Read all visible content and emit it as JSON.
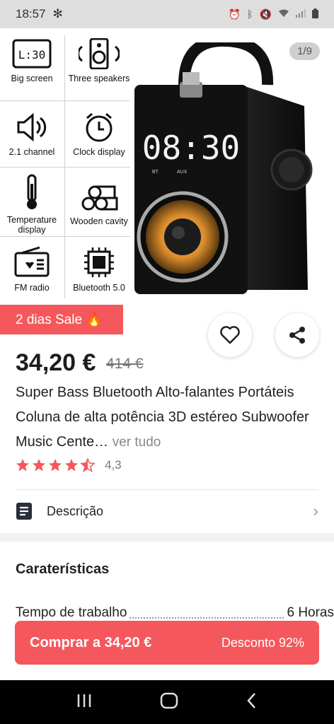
{
  "status": {
    "time": "18:57"
  },
  "hero": {
    "page_indicator": "1/9",
    "features": [
      {
        "label": "Big screen",
        "icon": "clock-display-icon"
      },
      {
        "label": "Three speakers",
        "icon": "speaker-icon"
      },
      {
        "label": "2.1 channel",
        "icon": "volume-icon"
      },
      {
        "label": "Clock display",
        "icon": "alarm-clock-icon"
      },
      {
        "label": "Temperature display",
        "icon": "thermometer-icon"
      },
      {
        "label": "Wooden cavity",
        "icon": "wood-logs-icon"
      },
      {
        "label": "FM radio",
        "icon": "radio-icon"
      },
      {
        "label": "Bluetooth 5.0",
        "icon": "chip-icon"
      }
    ],
    "speaker_display": "08:30",
    "speaker_labels": [
      "BT",
      "AUX"
    ]
  },
  "sale": {
    "label": "2 dias Sale 🔥"
  },
  "product": {
    "price": "34,20 €",
    "old_price": "414 €",
    "title": "Super Bass Bluetooth Alto-falantes Portáteis Coluna de alta potência 3D estéreo Subwoofer Music Cente…",
    "more": "ver tudo",
    "rating": 4.3,
    "rating_label": "4,3"
  },
  "description": {
    "label": "Descrição"
  },
  "characteristics": {
    "title": "Caraterísticas",
    "rows": [
      {
        "label": "Tempo de trabalho",
        "value": "6 Horas"
      }
    ]
  },
  "buy_bar": {
    "cta": "Comprar a 34,20 €",
    "discount": "Desconto 92%"
  },
  "colors": {
    "accent": "#f4585c",
    "star": "#f4585c"
  }
}
